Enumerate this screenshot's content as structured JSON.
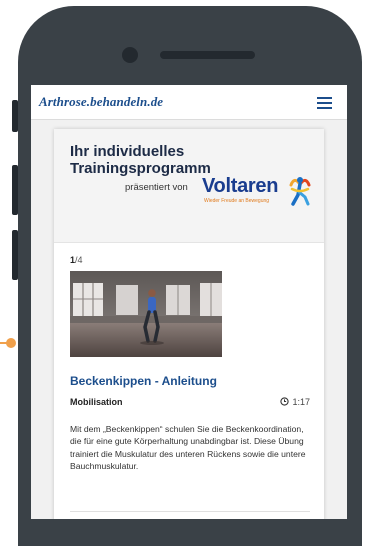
{
  "brand": "Arthrose.behandeln.de",
  "card": {
    "title": "Ihr individuelles Trainingsprogramm",
    "presented_by": "präsentiert von",
    "sponsor": {
      "name": "Voltaren",
      "tagline": "Wieder Freude an Bewegung"
    }
  },
  "exercise": {
    "index": "1",
    "total": "/4",
    "title": "Beckenkippen - Anleitung",
    "category": "Mobilisation",
    "duration": "1:17",
    "description": "Mit dem „Beckenkippen“ schulen Sie die Beckenkoordination, die für eine gute Körperhaltung unabdingbar ist. Diese Übung trainiert die Muskulatur des unteren Rückens sowie die untere Bauchmuskulatur."
  },
  "colors": {
    "brand_blue": "#1c4e8c",
    "accent_orange": "#f0a04b",
    "phone_body": "#3a4147"
  }
}
